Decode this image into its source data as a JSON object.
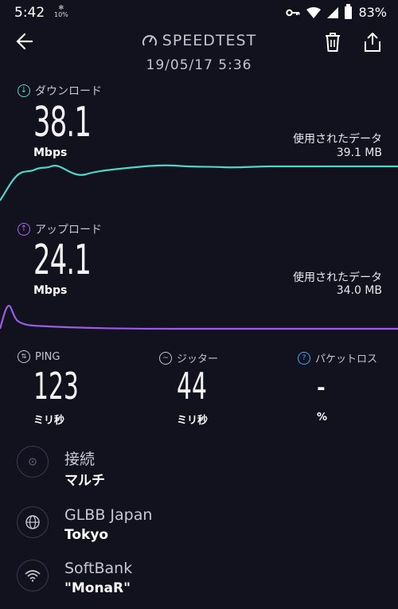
{
  "status_bar": {
    "time": "5:42",
    "small_indicator": "10%",
    "battery": "83%"
  },
  "header": {
    "title": "SPEEDTEST",
    "datetime": "19/05/17 5:36"
  },
  "download": {
    "label": "ダウンロード",
    "value": "38.1",
    "unit": "Mbps",
    "used_label": "使用されたデータ",
    "used_value": "39.1 MB",
    "color": "#4fd6c8"
  },
  "upload": {
    "label": "アップロード",
    "value": "24.1",
    "unit": "Mbps",
    "used_label": "使用されたデータ",
    "used_value": "34.0 MB",
    "color": "#9b5de5"
  },
  "stats": {
    "ping": {
      "label": "PING",
      "value": "123",
      "unit": "ミリ秒"
    },
    "jitter": {
      "label": "ジッター",
      "value": "44",
      "unit": "ミリ秒"
    },
    "packet_loss": {
      "label": "パケットロス",
      "value": "-",
      "unit": "%"
    }
  },
  "info": {
    "connection": {
      "title": "接続",
      "value": "マルチ",
      "icon": "connection-icon"
    },
    "server": {
      "title": "GLBB Japan",
      "value": "Tokyo",
      "icon": "globe-icon"
    },
    "provider": {
      "title": "SoftBank",
      "value": "\"MonaR\"",
      "icon": "wifi-icon"
    }
  }
}
